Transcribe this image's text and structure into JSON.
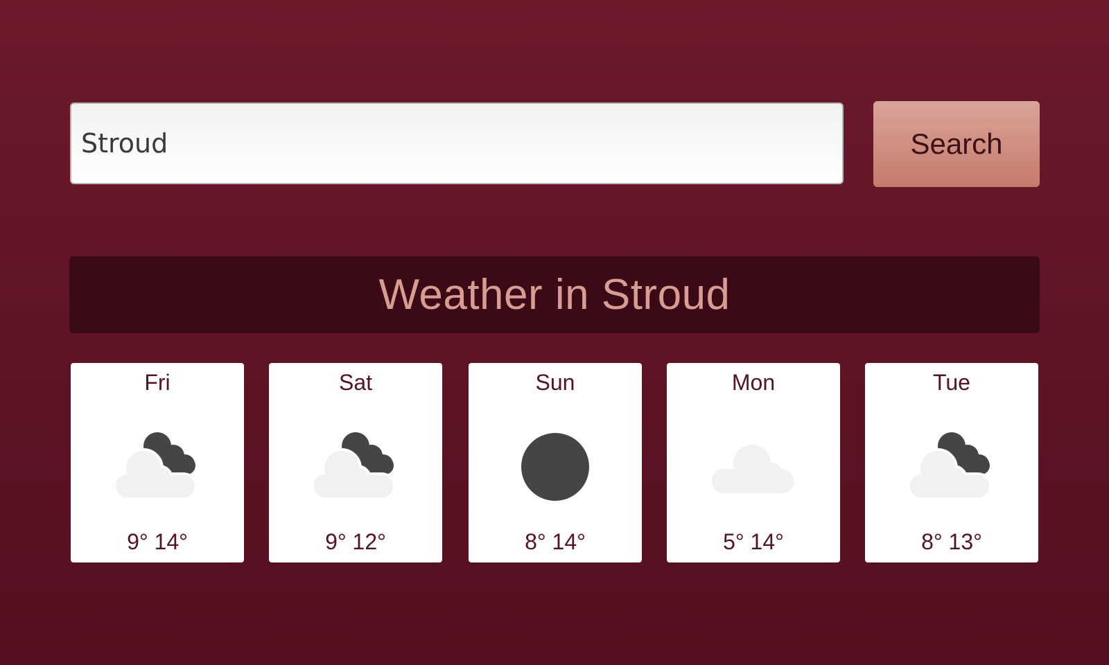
{
  "search": {
    "value": "Stroud",
    "button_label": "Search"
  },
  "header": {
    "title": "Weather in Stroud"
  },
  "colors": {
    "background_top": "#6d1a2b",
    "background_bottom": "#541020",
    "title_bar": "#3c0a16",
    "title_text": "#d79c92",
    "button_top": "#d9a49a",
    "button_bottom": "#c67a6a",
    "card": "#ffffff",
    "card_text": "#521525",
    "dark_icon": "#454547",
    "light_cloud": "#f1f1f0"
  },
  "forecast": [
    {
      "day": "Fri",
      "icon": "partly-cloudy-night-icon",
      "temps": "9° 14°"
    },
    {
      "day": "Sat",
      "icon": "partly-cloudy-night-icon",
      "temps": "9° 12°"
    },
    {
      "day": "Sun",
      "icon": "clear-night-icon",
      "temps": "8° 14°"
    },
    {
      "day": "Mon",
      "icon": "cloud-icon",
      "temps": "5° 14°"
    },
    {
      "day": "Tue",
      "icon": "partly-cloudy-night-icon",
      "temps": "8° 13°"
    }
  ]
}
